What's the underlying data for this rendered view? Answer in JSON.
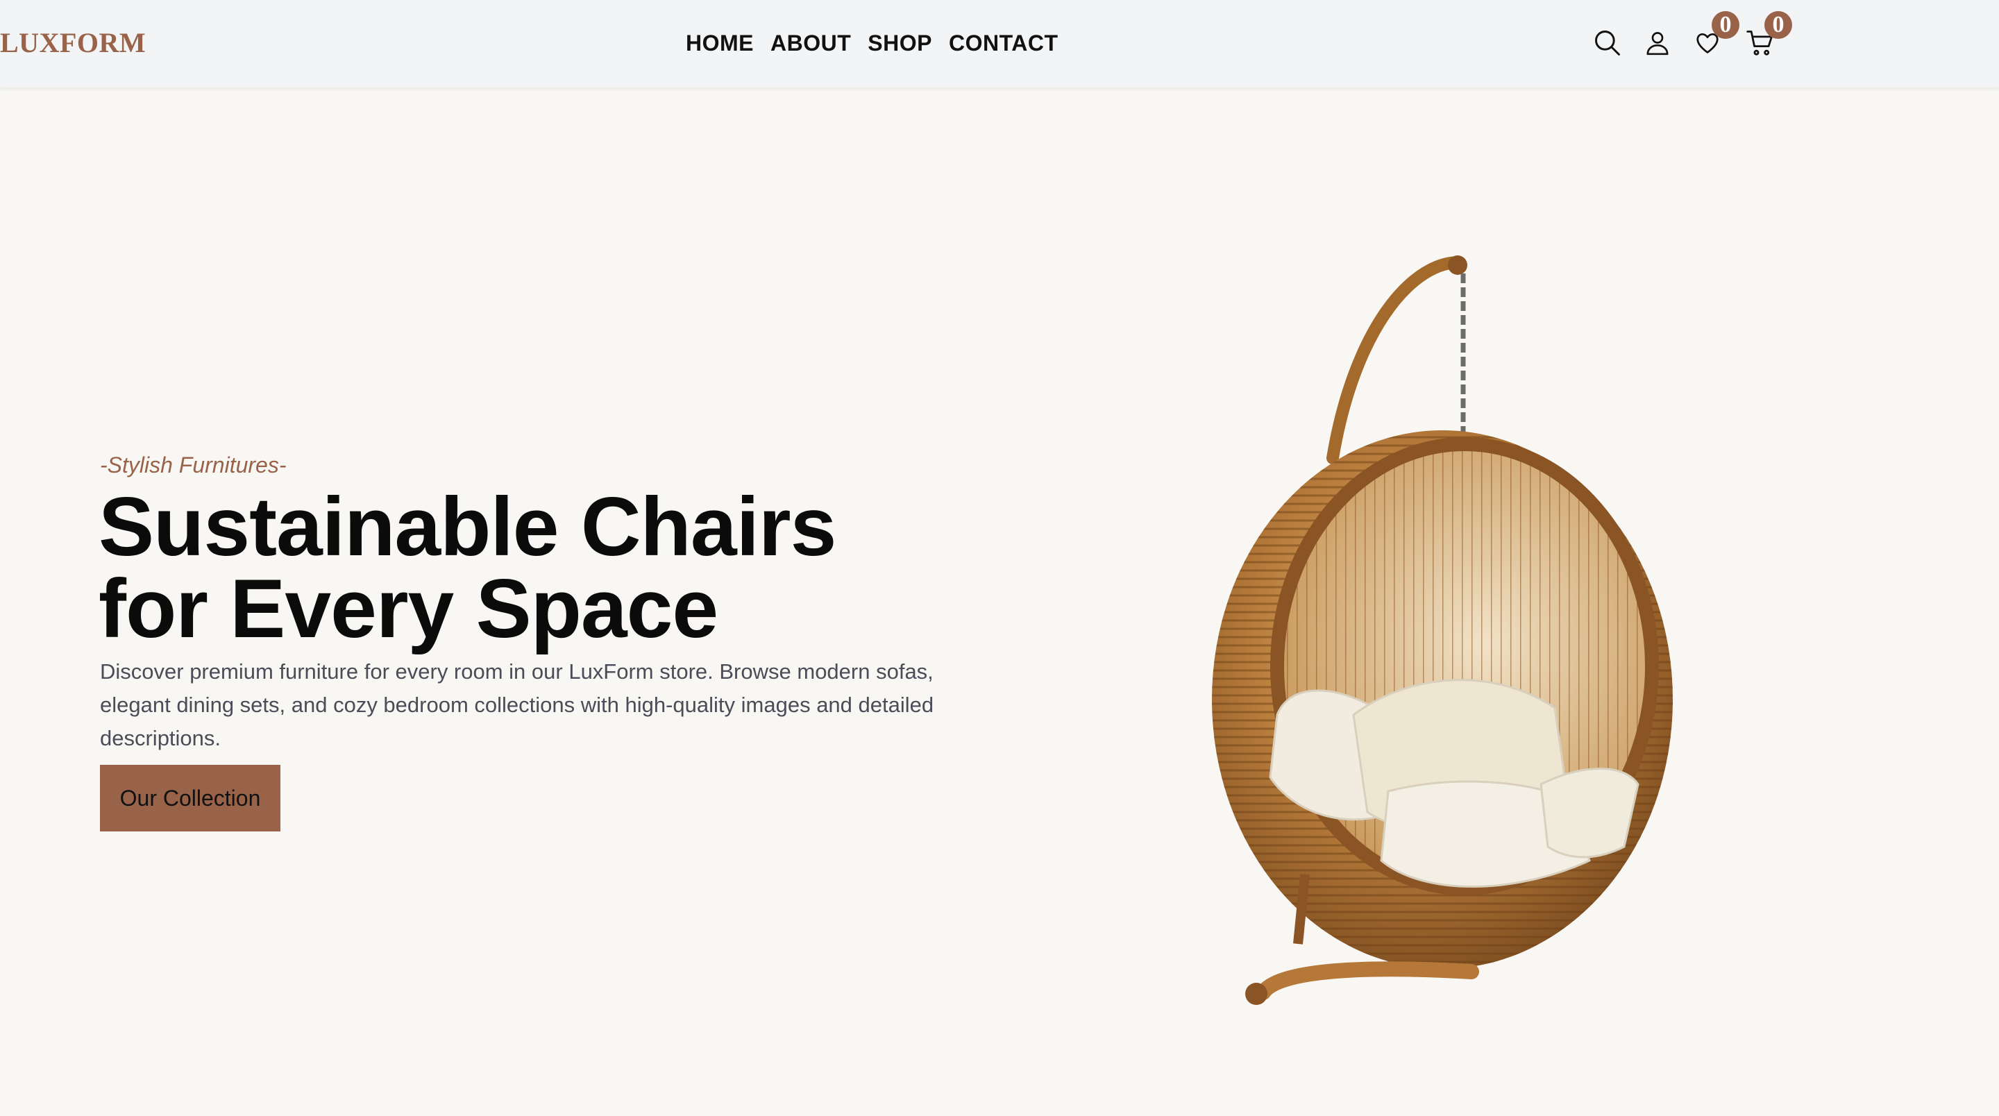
{
  "brand": {
    "logo": "LUXFORM",
    "accent": "#99634a"
  },
  "nav": {
    "items": [
      {
        "label": "HOME"
      },
      {
        "label": "ABOUT"
      },
      {
        "label": "SHOP"
      },
      {
        "label": "CONTACT"
      }
    ]
  },
  "header_icons": {
    "search": "search-icon",
    "account": "user-icon",
    "wishlist": {
      "icon": "heart-icon",
      "count": "0"
    },
    "cart": {
      "icon": "cart-icon",
      "count": "0"
    }
  },
  "hero": {
    "subtitle": "-Stylish Furnitures-",
    "title_line1": "Sustainable Chairs",
    "title_line2": "for Every Space",
    "description": "Discover premium furniture for every room in our LuxForm store. Browse modern sofas, elegant dining sets, and cozy bedroom collections with high-quality images and detailed descriptions.",
    "cta_label": "Our Collection"
  }
}
